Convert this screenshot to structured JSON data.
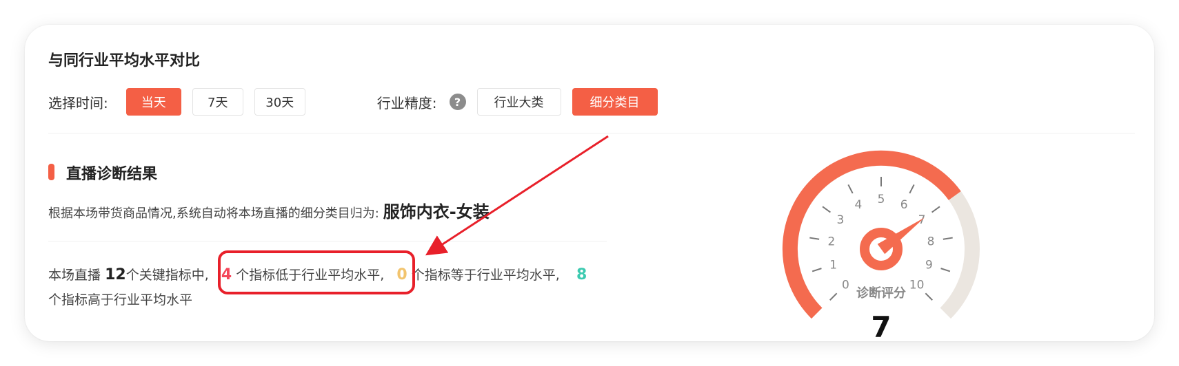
{
  "panel": {
    "title": "与同行业平均水平对比"
  },
  "time_filter": {
    "label": "选择时间:",
    "options": [
      {
        "label": "当天",
        "active": true
      },
      {
        "label": "7天",
        "active": false
      },
      {
        "label": "30天",
        "active": false
      }
    ]
  },
  "industry_filter": {
    "label": "行业精度:",
    "help_icon": "question-icon",
    "options": [
      {
        "label": "行业大类",
        "active": false
      },
      {
        "label": "细分类目",
        "active": true
      }
    ]
  },
  "diagnosis": {
    "title": "直播诊断结果",
    "desc_prefix": "根据本场带货商品情况,系统自动将本场直播的细分类目归为:",
    "category": "服饰内衣-女装",
    "summary": {
      "p1": "本场直播",
      "total": "12",
      "p2": "个关键指标中,",
      "lower": "4",
      "p3": "个指标低于行业平均水平,",
      "equal": "0",
      "p4": "个指标等于行业平均水平,",
      "higher": "8",
      "p5": "个指标高于行业平均水平"
    }
  },
  "gauge": {
    "label": "诊断评分",
    "score_text": "7",
    "score": 7,
    "min": 0,
    "max": 10,
    "ticks": [
      "0",
      "1",
      "2",
      "3",
      "4",
      "5",
      "6",
      "7",
      "8",
      "9",
      "10"
    ],
    "colors": {
      "fill": "#f46b4f",
      "track": "#ebe6e0",
      "needle": "#f46b4f"
    }
  },
  "annotation": {
    "color": "#e8202a"
  }
}
